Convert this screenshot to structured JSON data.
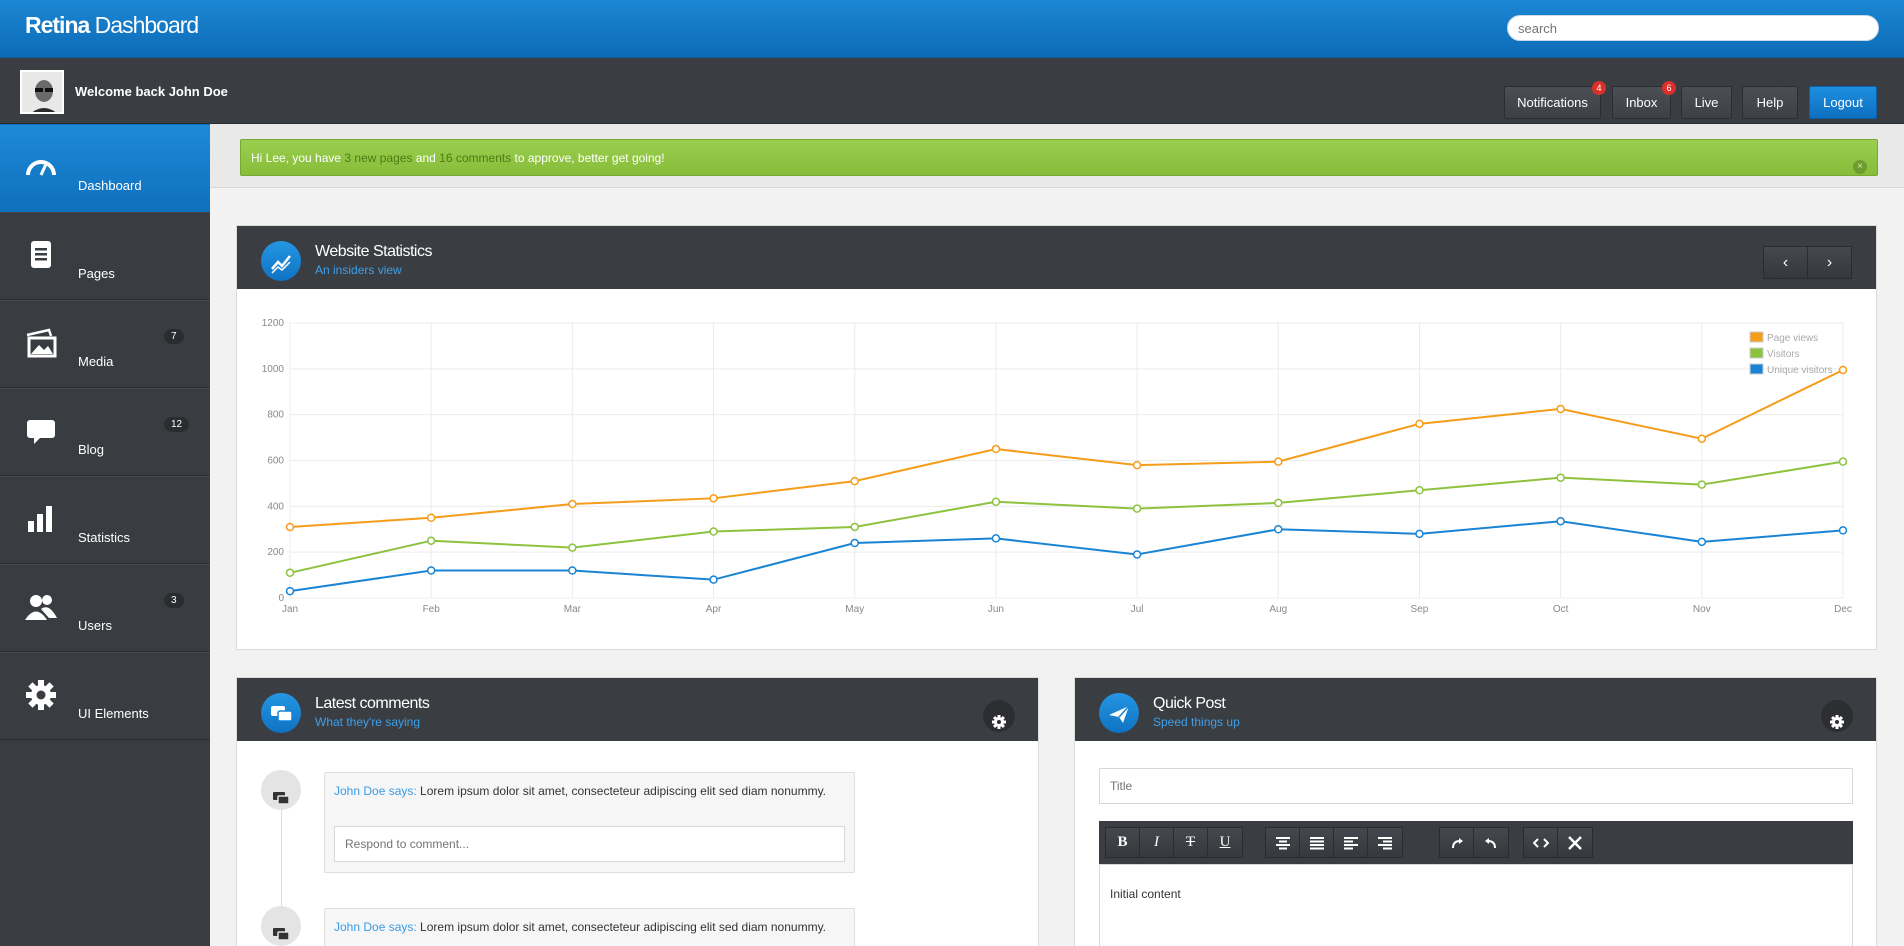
{
  "app": {
    "brand_bold": "Retina",
    "brand_rest": " Dashboard",
    "search_placeholder": "search"
  },
  "userbar": {
    "welcome": "Welcome back John Doe",
    "buttons": [
      {
        "label": "Notifications",
        "badge": "4"
      },
      {
        "label": "Inbox",
        "badge": "6"
      },
      {
        "label": "Live"
      },
      {
        "label": "Help"
      },
      {
        "label": "Logout"
      }
    ]
  },
  "sidebar": {
    "items": [
      {
        "label": "Dashboard",
        "icon": "speedometer-icon",
        "active": true
      },
      {
        "label": "Pages",
        "icon": "document-icon"
      },
      {
        "label": "Media",
        "icon": "image-icon",
        "count": "7"
      },
      {
        "label": "Blog",
        "icon": "speech-bubble-icon",
        "count": "12"
      },
      {
        "label": "Statistics",
        "icon": "bar-chart-icon"
      },
      {
        "label": "Users",
        "icon": "users-icon",
        "count": "3"
      },
      {
        "label": "UI Elements",
        "icon": "gear-icon"
      }
    ]
  },
  "alert": {
    "part1": "Hi Lee, you have ",
    "highlight1": "3 new pages",
    "part2": " and ",
    "highlight2": "16 comments",
    "part3": " to approve, better get going!",
    "close": "×"
  },
  "stats_panel": {
    "title": "Website Statistics",
    "subtitle": "An insiders view",
    "prev": "‹",
    "next": "›"
  },
  "chart_data": {
    "type": "line",
    "categories": [
      "Jan",
      "Feb",
      "Mar",
      "Apr",
      "May",
      "Jun",
      "Jul",
      "Aug",
      "Sep",
      "Oct",
      "Nov",
      "Dec"
    ],
    "ylim": [
      0,
      1200
    ],
    "yticks": [
      "0",
      "200",
      "400",
      "600",
      "800",
      "1000",
      "1200"
    ],
    "grid": true,
    "legend_position": "top-right",
    "series": [
      {
        "name": "Page views",
        "color": "#f59d1a",
        "values": [
          310,
          350,
          410,
          435,
          510,
          650,
          580,
          595,
          760,
          825,
          695,
          995
        ]
      },
      {
        "name": "Visitors",
        "color": "#8dc23f",
        "values": [
          110,
          250,
          220,
          290,
          310,
          420,
          390,
          415,
          470,
          525,
          495,
          595
        ]
      },
      {
        "name": "Unique visitors",
        "color": "#1a84d4",
        "values": [
          30,
          120,
          120,
          80,
          240,
          260,
          190,
          300,
          280,
          335,
          245,
          295
        ]
      }
    ]
  },
  "comments_panel": {
    "title": "Latest comments",
    "subtitle": "What they're saying",
    "comments": [
      {
        "author": "John Doe says:",
        "text": " Lorem ipsum dolor sit amet, consecteteur adipiscing elit sed diam nonummy.",
        "reply_placeholder": "Respond to comment..."
      },
      {
        "author": "John Doe says:",
        "text": " Lorem ipsum dolor sit amet, consecteteur adipiscing elit sed diam nonummy."
      }
    ]
  },
  "quickpost_panel": {
    "title": "Quick Post",
    "subtitle": "Speed things up",
    "title_placeholder": "Title",
    "toolbar": {
      "bold": "B",
      "italic": "I",
      "strike": "T",
      "underline": "U"
    },
    "editor_content": "Initial content"
  }
}
